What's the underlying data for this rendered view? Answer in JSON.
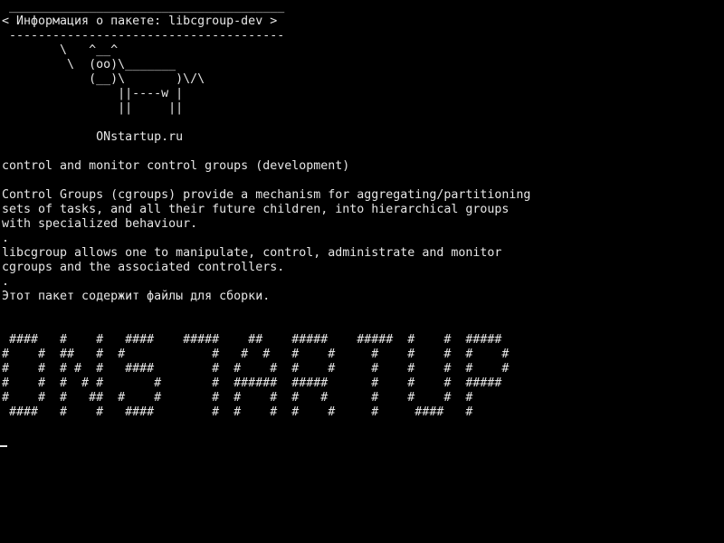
{
  "screen": {
    "lines": [
      " ______________________________________",
      "< Информация о пакете: libcgroup-dev >",
      " --------------------------------------",
      "        \\   ^__^",
      "         \\  (oo)\\_______",
      "            (__)\\       )\\/\\",
      "                ||----w |",
      "                ||     ||",
      "",
      "             ONstartup.ru",
      "",
      "control and monitor control groups (development)",
      "",
      "Control Groups (cgroups) provide a mechanism for aggregating/partitioning",
      "sets of tasks, and all their future children, into hierarchical groups",
      "with specialized behaviour.",
      ".",
      "libcgroup allows one to manipulate, control, administrate and monitor",
      "cgroups and the associated controllers.",
      ".",
      "Этот пакет содержит файлы для сборки.",
      "",
      "",
      " ####   #    #   ####    #####    ##    #####    #####  #    #  #####",
      "#    #  ##   #  #            #   #  #   #    #     #    #    #  #    #",
      "#    #  # #  #   ####        #  #    #  #    #     #    #    #  #    #",
      "#    #  #  # #       #       #  ######  #####      #    #    #  #####",
      "#    #  #   ##  #    #       #  #    #  #   #      #    #    #  #",
      " ####   #    #   ####        #  #    #  #    #     #     ####   #"
    ],
    "prompt": ""
  }
}
